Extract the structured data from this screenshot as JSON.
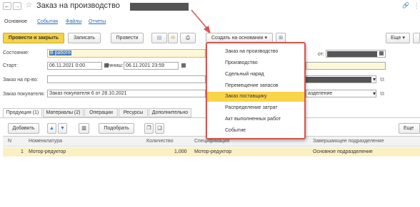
{
  "window": {
    "title": "Заказ на производство",
    "back": "←",
    "forward": "→",
    "star": "☆",
    "link_icon": "🔗",
    "more": "⋮"
  },
  "top_tabs": [
    "Основное",
    "События",
    "Файлы",
    "Отчеты"
  ],
  "toolbar": {
    "post_close": "Провести и закрыть",
    "write": "Записать",
    "post": "Провести",
    "create_based": "Создать на основании",
    "more": "Еще"
  },
  "form": {
    "state_label": "Состояние:",
    "state_value": "В работе",
    "from_label": "от:",
    "start_label": "Старт:",
    "start_value": "06.11.2021  0:00",
    "finish_label": "Финиш:",
    "finish_value": "06.11.2021 23:59",
    "order_label": "Заказ на пр-во:",
    "buyer_order_label": "Заказ покупателя:",
    "buyer_order_value": "Заказ покупателя 6 от 28.10.2021",
    "division_value": "азделение"
  },
  "menu": {
    "items": [
      "Заказ на производство",
      "Производство",
      "Сдельный наряд",
      "Перемещение запасов",
      "Заказ поставщику",
      "Распределение затрат",
      "Акт выполненных работ",
      "Событие"
    ],
    "active_index": 4
  },
  "doc_tabs": [
    "Продукция (1)",
    "Материалы (2)",
    "Операции",
    "Ресурсы",
    "Дополнительно"
  ],
  "table_toolbar": {
    "add": "Добавить",
    "select": "Подобрать",
    "more": "Еще"
  },
  "table": {
    "headers": [
      "N",
      "Номенклатура",
      "Количество",
      "Спецификация",
      "Завершающее подразделение"
    ],
    "rows": [
      {
        "n": "1",
        "item": "Мотор-редуктор",
        "qty": "1,000",
        "spec": "Мотор-редуктор",
        "division": "Основное подразделение"
      }
    ]
  },
  "colors": {
    "accent": "#f9d44a",
    "menu_border": "#d9534f",
    "selected_row": "#fbf0c4"
  }
}
